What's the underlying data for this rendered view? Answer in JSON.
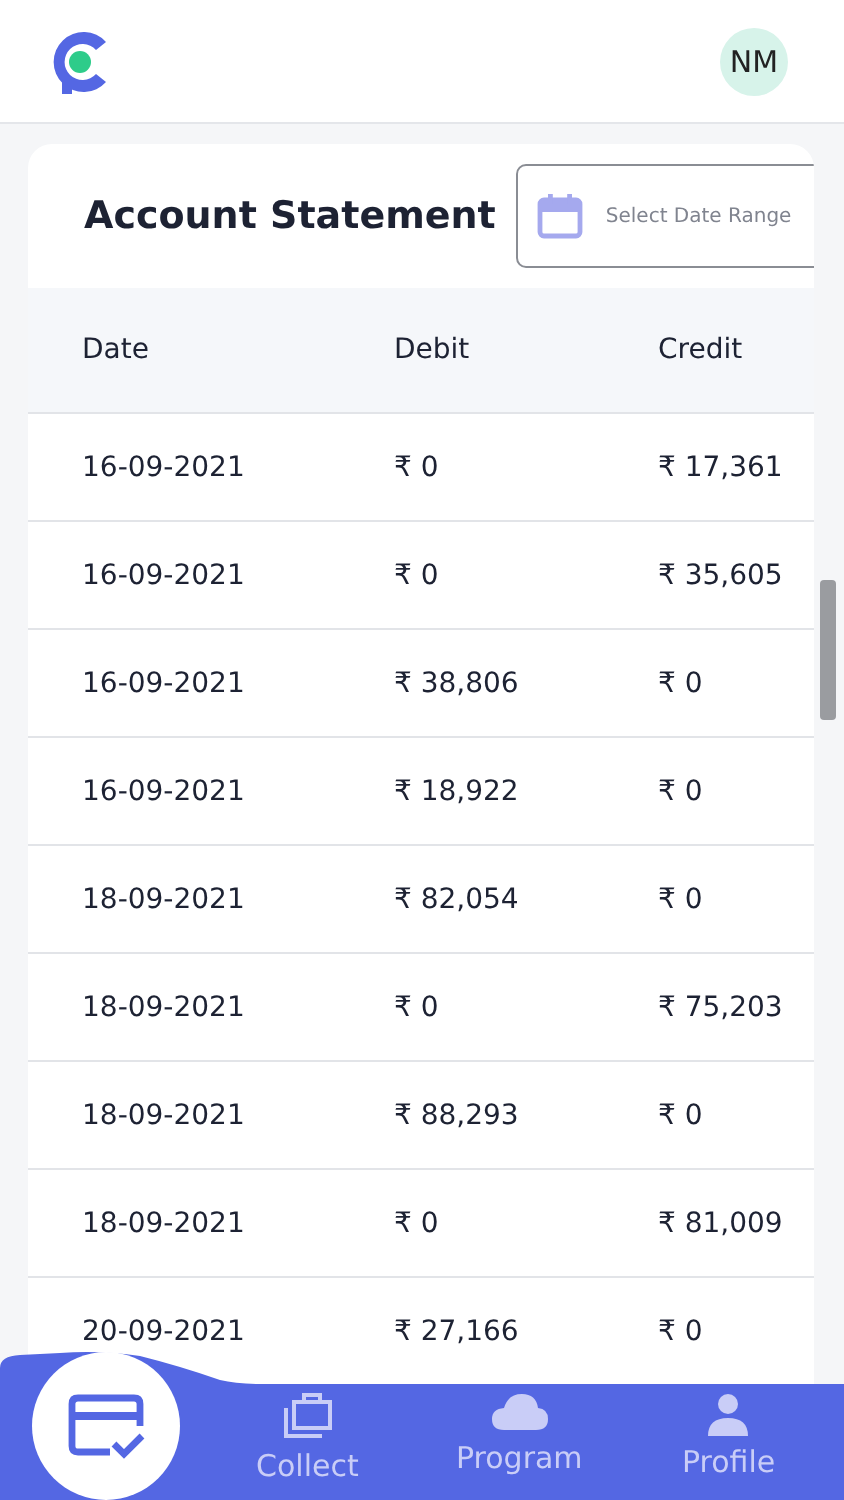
{
  "header": {
    "avatar": "NM"
  },
  "statement": {
    "title": "Account Statement",
    "date_range": {
      "placeholder": "Select Date Range"
    },
    "columns": [
      "Date",
      "Debit",
      "Credit"
    ],
    "rows": [
      [
        "16-09-2021",
        "₹ 0",
        "₹ 17,361"
      ],
      [
        "16-09-2021",
        "₹ 0",
        "₹ 35,605"
      ],
      [
        "16-09-2021",
        "₹ 38,806",
        "₹ 0"
      ],
      [
        "16-09-2021",
        "₹ 18,922",
        "₹ 0"
      ],
      [
        "18-09-2021",
        "₹ 82,054",
        "₹ 0"
      ],
      [
        "18-09-2021",
        "₹ 0",
        "₹ 75,203"
      ],
      [
        "18-09-2021",
        "₹ 88,293",
        "₹ 0"
      ],
      [
        "18-09-2021",
        "₹ 0",
        "₹ 81,009"
      ],
      [
        "20-09-2021",
        "₹ 27,166",
        "₹ 0"
      ]
    ]
  },
  "nav": [
    {
      "kind": "card",
      "selected": true
    },
    {
      "kind": "collect",
      "label": "Collect",
      "selected": false
    },
    {
      "kind": "program",
      "label": "Program",
      "selected": false
    },
    {
      "kind": "profile",
      "label": "Profile",
      "selected": false
    }
  ]
}
